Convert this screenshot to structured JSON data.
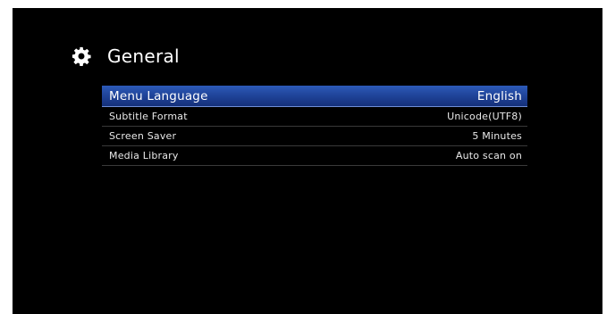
{
  "header": {
    "title": "General",
    "icon": "gear-icon"
  },
  "colors": {
    "background": "#000000",
    "highlight": "#1f4398",
    "text": "#ffffff"
  },
  "menu": {
    "items": [
      {
        "label": "Menu Language",
        "value": "English",
        "selected": true
      },
      {
        "label": "Subtitle Format",
        "value": "Unicode(UTF8)",
        "selected": false
      },
      {
        "label": "Screen Saver",
        "value": "5 Minutes",
        "selected": false
      },
      {
        "label": "Media Library",
        "value": "Auto scan on",
        "selected": false
      }
    ]
  }
}
